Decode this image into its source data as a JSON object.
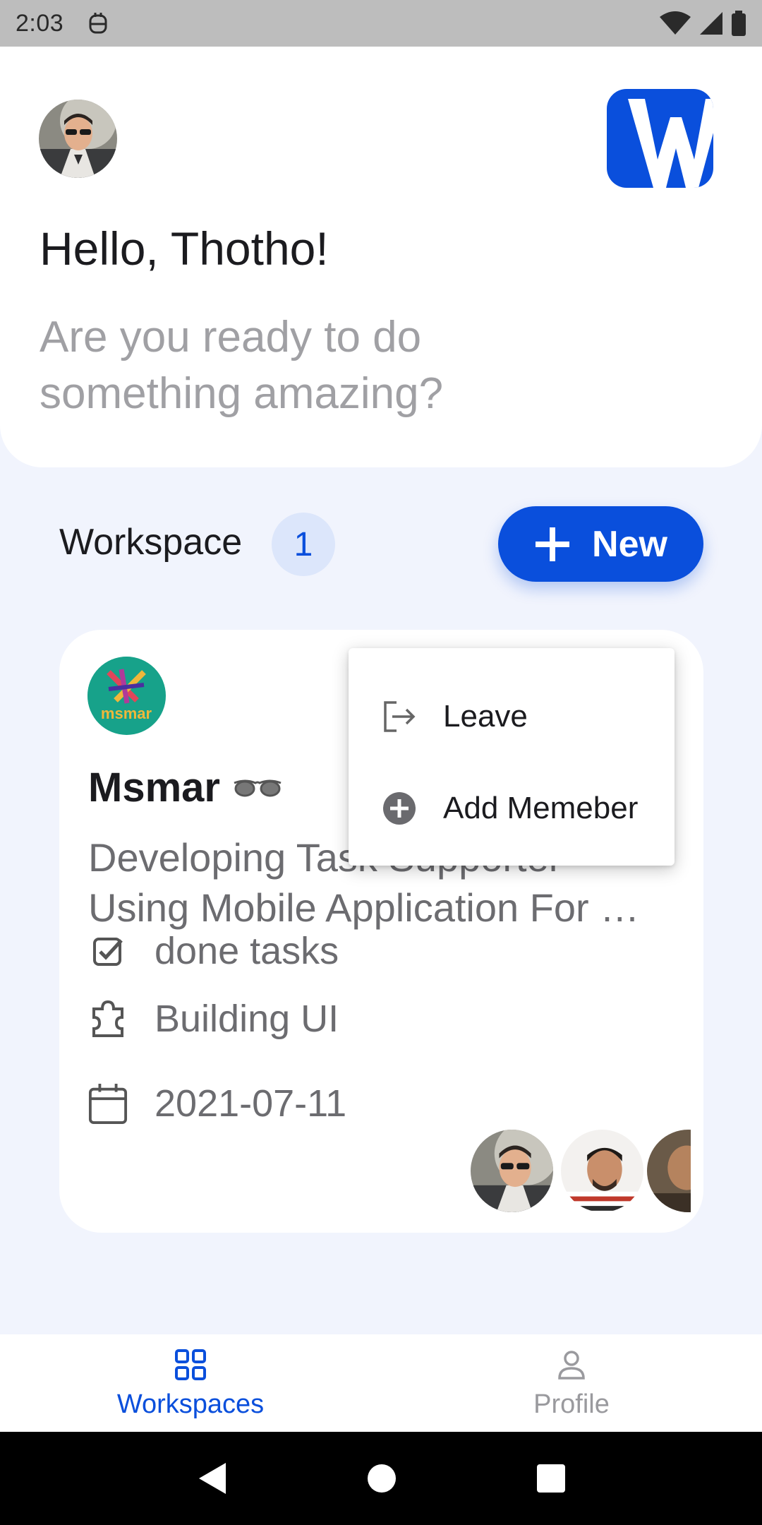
{
  "status_bar": {
    "time": "2:03"
  },
  "header": {
    "greeting": "Hello, Thotho!",
    "subtitle": "Are you ready to do something amazing?"
  },
  "workspace_section": {
    "label": "Workspace",
    "count": "1",
    "new_button_label": "New"
  },
  "workspace_card": {
    "name": "Msmar",
    "logo_text": "msmar",
    "description_line1": "Developing Task Supporter",
    "description_line2": "Using Mobile Application For …",
    "tasks_label": "done tasks",
    "phase_label": "Building UI",
    "date": "2021-07-11"
  },
  "popup_menu": {
    "items": [
      {
        "label": "Leave",
        "icon": "logout-icon"
      },
      {
        "label": "Add Memeber",
        "icon": "add-circle-icon"
      }
    ]
  },
  "bottom_nav": {
    "items": [
      {
        "label": "Workspaces",
        "icon": "grid-icon",
        "active": true
      },
      {
        "label": "Profile",
        "icon": "person-icon",
        "active": false
      }
    ]
  },
  "colors": {
    "primary": "#0a4fdc",
    "background": "#f1f4fd",
    "muted_text": "#6c6c70",
    "workspace_logo": "#17a28a"
  }
}
